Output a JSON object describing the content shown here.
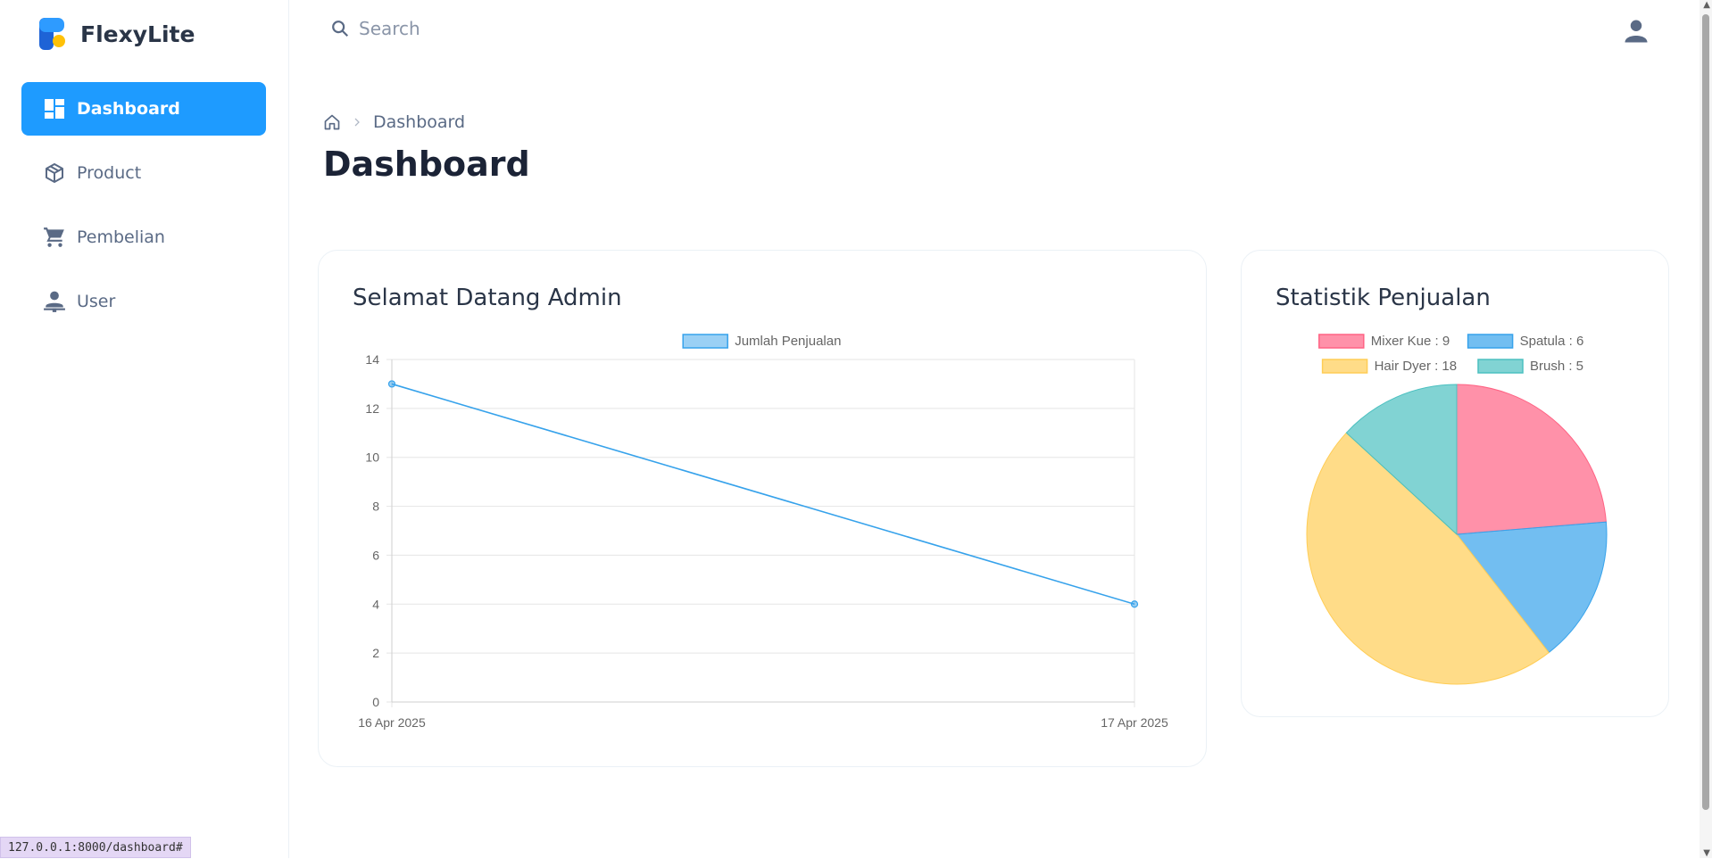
{
  "app": {
    "name": "FlexyLite"
  },
  "sidebar": {
    "items": [
      {
        "label": "Dashboard",
        "icon": "dashboard-icon",
        "active": true
      },
      {
        "label": "Product",
        "icon": "box-icon",
        "active": false
      },
      {
        "label": "Pembelian",
        "icon": "cart-icon",
        "active": false
      },
      {
        "label": "User",
        "icon": "user-icon",
        "active": false
      }
    ]
  },
  "topbar": {
    "search_placeholder": "Search"
  },
  "breadcrumb": {
    "current": "Dashboard"
  },
  "page": {
    "title": "Dashboard"
  },
  "cards": {
    "welcome_title": "Selamat Datang Admin",
    "stats_title": "Statistik Penjualan"
  },
  "colors": {
    "accent": "#1e9bff",
    "line": "#36a2eb",
    "pink": "#ff6384",
    "blue": "#36a2eb",
    "yellow": "#ffcd56",
    "teal": "#4bc0c0"
  },
  "chart_data": [
    {
      "type": "line",
      "x": [
        "16 Apr 2025",
        "17 Apr 2025"
      ],
      "series": [
        {
          "name": "Jumlah Penjualan",
          "values": [
            13,
            4
          ]
        }
      ],
      "ylim": [
        0,
        14
      ],
      "yticks": [
        0,
        2,
        4,
        6,
        8,
        10,
        12,
        14
      ],
      "grid": true,
      "legend": "top"
    },
    {
      "type": "pie",
      "labels": [
        "Mixer Kue : 9",
        "Spatula : 6",
        "Hair Dyer : 18",
        "Brush : 5"
      ],
      "values": [
        9,
        6,
        18,
        5
      ],
      "colors": [
        "#ff6384",
        "#36a2eb",
        "#ffcd56",
        "#4bc0c0"
      ],
      "legend": "top"
    }
  ],
  "status_bar": {
    "url": "127.0.0.1:8000/dashboard#"
  }
}
